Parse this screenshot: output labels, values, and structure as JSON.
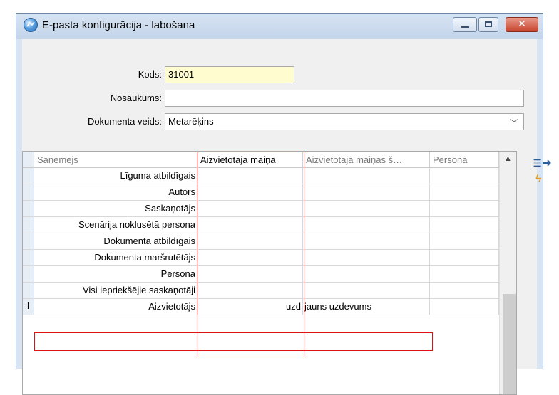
{
  "window": {
    "title": "E-pasta konfigurācija - labošana",
    "icon": "app-globe-icon"
  },
  "form": {
    "kods_label": "Kods:",
    "kods_value": "31001",
    "nosaukums_label": "Nosaukums:",
    "nosaukums_value": "",
    "doc_type_label": "Dokumenta veids:",
    "doc_type_value": "Metarēķins"
  },
  "grid": {
    "columns": [
      {
        "label": "Saņēmējs"
      },
      {
        "label": "Aizvietotāja maiņa"
      },
      {
        "label": "Aizvietotāja maiņas š…"
      },
      {
        "label": "Persona"
      }
    ],
    "rows": [
      {
        "recipient": "Līguma atbildīgais",
        "replace": "",
        "replace_s": "",
        "person": ""
      },
      {
        "recipient": "Autors",
        "replace": "",
        "replace_s": "",
        "person": ""
      },
      {
        "recipient": "Saskaņotājs",
        "replace": "",
        "replace_s": "",
        "person": ""
      },
      {
        "recipient": "Scenārija noklusētā persona",
        "replace": "",
        "replace_s": "",
        "person": ""
      },
      {
        "recipient": "Dokumenta atbildīgais",
        "replace": "",
        "replace_s": "",
        "person": ""
      },
      {
        "recipient": "Dokumenta maršrutētājs",
        "replace": "",
        "replace_s": "",
        "person": ""
      },
      {
        "recipient": "Persona",
        "replace": "",
        "replace_s": "",
        "person": ""
      },
      {
        "recipient": "Visi iepriekšējie saskaņotāji",
        "replace": "",
        "replace_s": "",
        "person": ""
      },
      {
        "recipient": "Aizvietotājs",
        "replace": "uzd",
        "replace_s": "jauns uzdevums",
        "person": ""
      }
    ],
    "active_row_marker": "I"
  },
  "side_tools": {
    "export_icon": "list-arrow-icon",
    "action_icon": "lightning-icon"
  },
  "colors": {
    "highlight_border": "#dd1111",
    "kods_background": "#fffdd0"
  }
}
